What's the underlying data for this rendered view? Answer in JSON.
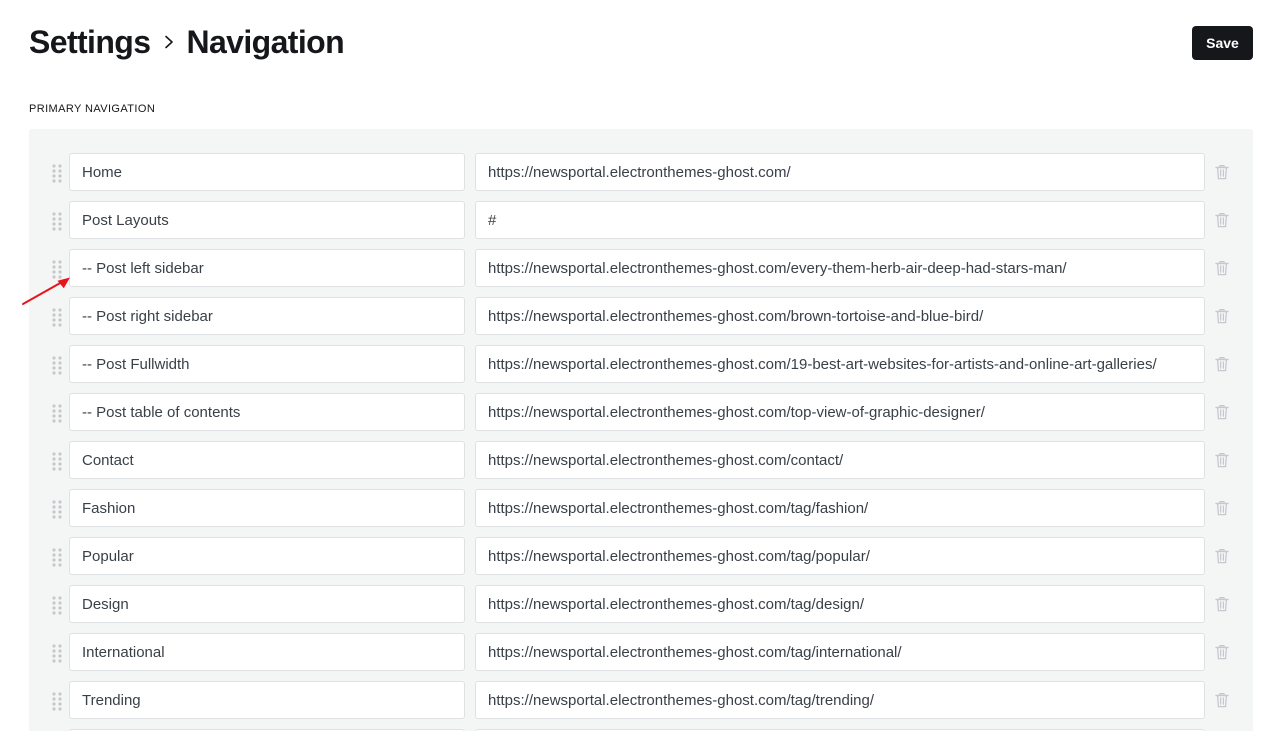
{
  "breadcrumb": {
    "parent": "Settings",
    "current": "Navigation"
  },
  "header": {
    "save_label": "Save"
  },
  "primary_navigation": {
    "heading": "PRIMARY NAVIGATION",
    "items": [
      {
        "label": "Home",
        "url": "https://newsportal.electronthemes-ghost.com/"
      },
      {
        "label": "Post Layouts",
        "url": "#"
      },
      {
        "label": "-- Post left sidebar",
        "url": "https://newsportal.electronthemes-ghost.com/every-them-herb-air-deep-had-stars-man/"
      },
      {
        "label": "-- Post right sidebar",
        "url": "https://newsportal.electronthemes-ghost.com/brown-tortoise-and-blue-bird/"
      },
      {
        "label": "-- Post Fullwidth",
        "url": "https://newsportal.electronthemes-ghost.com/19-best-art-websites-for-artists-and-online-art-galleries/"
      },
      {
        "label": "-- Post table of contents",
        "url": "https://newsportal.electronthemes-ghost.com/top-view-of-graphic-designer/"
      },
      {
        "label": "Contact",
        "url": "https://newsportal.electronthemes-ghost.com/contact/"
      },
      {
        "label": "Fashion",
        "url": "https://newsportal.electronthemes-ghost.com/tag/fashion/"
      },
      {
        "label": "Popular",
        "url": "https://newsportal.electronthemes-ghost.com/tag/popular/"
      },
      {
        "label": "Design",
        "url": "https://newsportal.electronthemes-ghost.com/tag/design/"
      },
      {
        "label": "International",
        "url": "https://newsportal.electronthemes-ghost.com/tag/international/"
      },
      {
        "label": "Trending",
        "url": "https://newsportal.electronthemes-ghost.com/tag/trending/"
      },
      {
        "label": "",
        "url": ""
      }
    ]
  },
  "colors": {
    "accent": "#15171a",
    "panel_background": "#f4f5f5",
    "input_border": "#dfe1e3",
    "icon_muted": "#c5c9cd",
    "annotation_arrow": "#e8141b"
  },
  "icons": {
    "breadcrumb_separator": "chevron-right-icon",
    "drag": "drag-handle-icon",
    "delete": "trash-icon",
    "annotation": "red-arrow-icon"
  }
}
